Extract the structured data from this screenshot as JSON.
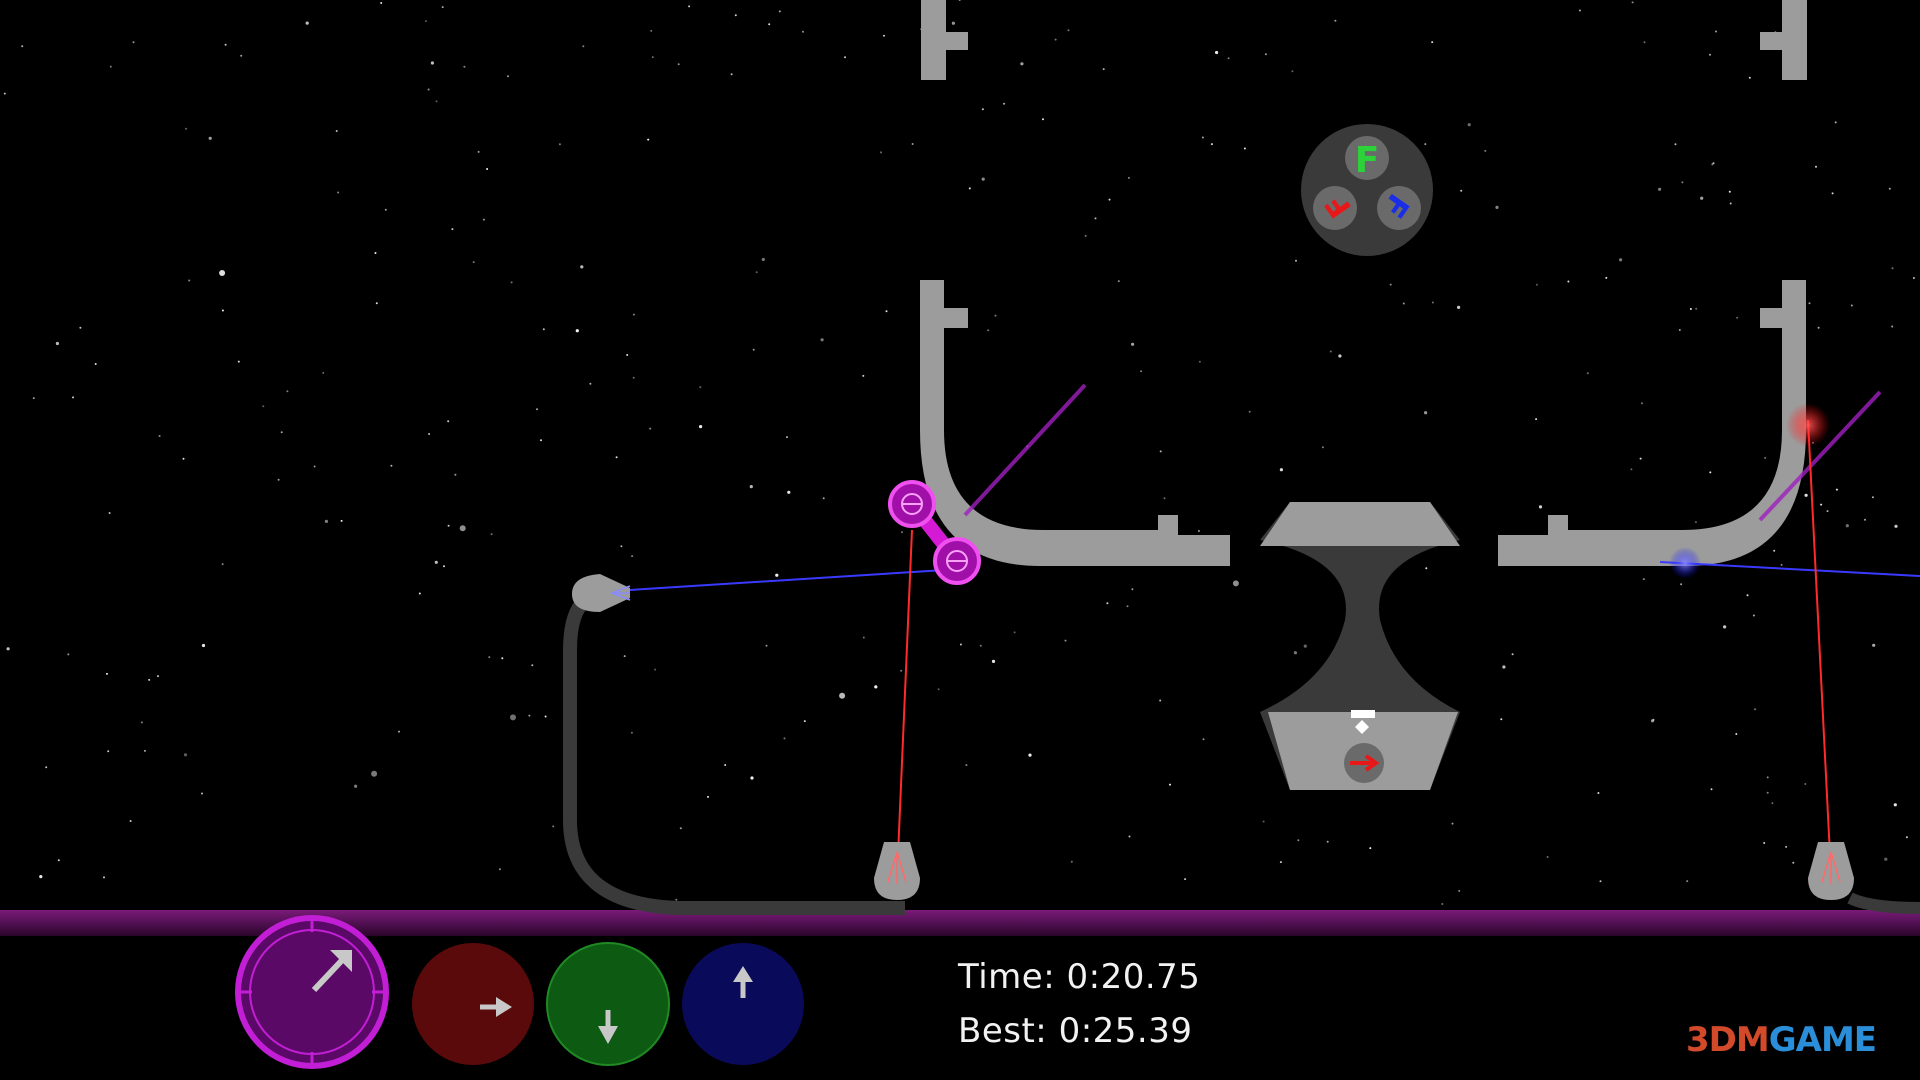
{
  "hud": {
    "time_label": "Time:",
    "time_value": "0:20.75",
    "best_label": "Best:",
    "best_value": "0:25.39"
  },
  "dials": [
    {
      "name": "purple-dial",
      "color": "#5a0a66",
      "ring": "#c21ed6",
      "arrow": "north-east",
      "selected": true
    },
    {
      "name": "red-dial",
      "color": "#5a0a0a",
      "arrow": "east",
      "selected": false
    },
    {
      "name": "green-dial",
      "color": "#0d5a12",
      "arrow": "south",
      "selected": false
    },
    {
      "name": "blue-dial",
      "color": "#0a0a5a",
      "arrow": "north",
      "selected": false
    }
  ],
  "gravity_selector": {
    "icon_letters": [
      "F",
      "F",
      "F"
    ],
    "colors": [
      "#2bd23a",
      "#e81818",
      "#1a2ee8"
    ]
  },
  "lasers": {
    "red": "#ff2a2a",
    "blue": "#3a3aff",
    "magenta": "#d41ad4"
  },
  "floor_color": "#5c0f5c",
  "watermark": {
    "part1": "3DM",
    "part2": "GAME"
  }
}
